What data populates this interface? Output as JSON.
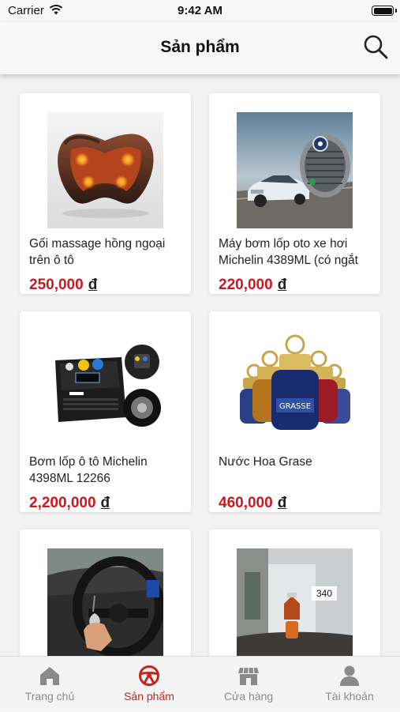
{
  "status_bar": {
    "carrier": "Carrier",
    "time": "9:42 AM"
  },
  "header": {
    "title": "Sản phẩm"
  },
  "products": [
    {
      "name": "Gối massage hồng ngoại trên ô tô",
      "price": "250,000",
      "currency": "đ",
      "image": "massage-pillow"
    },
    {
      "name": "Máy bơm lốp oto xe hơi Michelin 4389ML (có ngắt",
      "price": "220,000",
      "currency": "đ",
      "image": "tire-pump-car"
    },
    {
      "name": "Bơm lốp ô tô Michelin 4398ML 12266",
      "price": "2,200,000",
      "currency": "đ",
      "image": "michelin-pump"
    },
    {
      "name": "Nước Hoa Grase",
      "price": "460,000",
      "currency": "đ",
      "image": "grasse-perfume"
    },
    {
      "name": "",
      "price": "",
      "currency": "",
      "image": "car-interior-perfume"
    },
    {
      "name": "",
      "price": "",
      "currency": "",
      "image": "window-perfume",
      "badge": "340"
    }
  ],
  "tabs": [
    {
      "label": "Trang chủ",
      "icon": "home-icon",
      "active": false
    },
    {
      "label": "Sản phẩm",
      "icon": "steering-wheel-icon",
      "active": true
    },
    {
      "label": "Cửa hàng",
      "icon": "store-icon",
      "active": false
    },
    {
      "label": "Tài khoản",
      "icon": "user-icon",
      "active": false
    }
  ],
  "colors": {
    "accent": "#c8231d",
    "price": "#d0151e",
    "inactive": "#8a8a8a"
  }
}
